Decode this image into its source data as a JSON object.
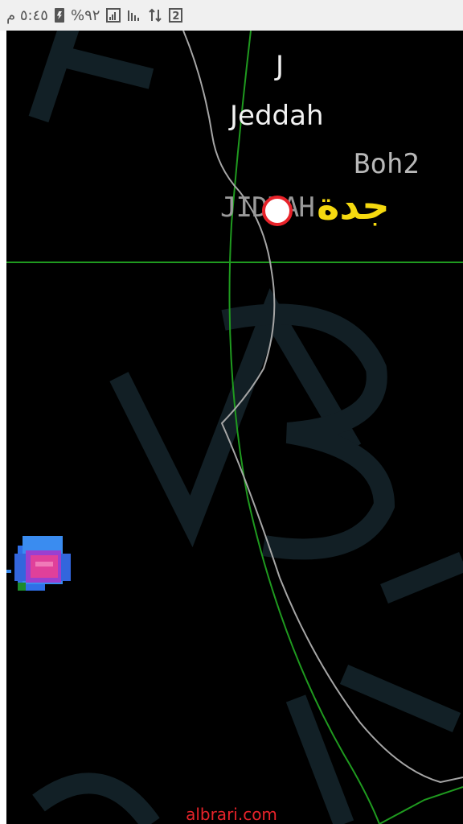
{
  "status_bar": {
    "time": "٥:٤٥ م",
    "battery_percent": "%٩٢",
    "sim_badge": "2",
    "icons": [
      "battery-charging-icon",
      "signal-icon",
      "signal-icon",
      "data-arrows-icon",
      "sim-2-icon"
    ]
  },
  "map": {
    "labels": {
      "j": "J",
      "jeddah": "Jeddah",
      "boh2": "Boh2",
      "jiddah": "JIDDAH",
      "arabic": "جدة"
    },
    "colors": {
      "background": "#000000",
      "green_lines": "#1f9a1f",
      "coastline": "#a6a6a6",
      "arabic_label": "#f5d90f",
      "city_marker_ring": "#e8232a",
      "watermark_text": "#1a2a2a"
    },
    "watermark_letters": "MB"
  },
  "footer": {
    "site": "albrari.com"
  }
}
